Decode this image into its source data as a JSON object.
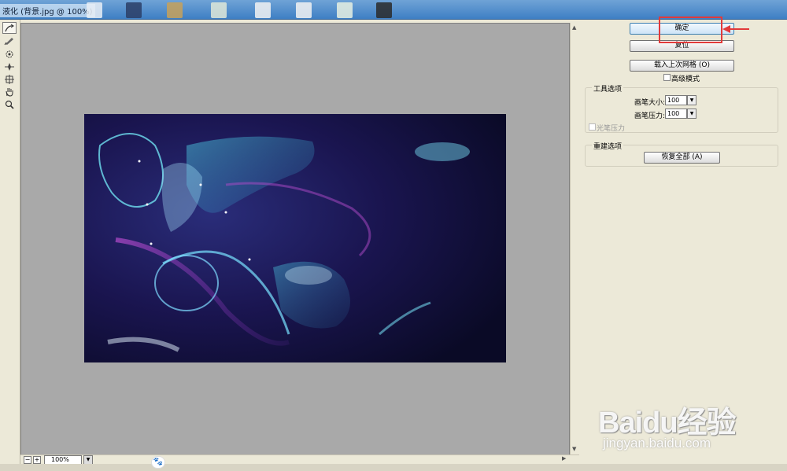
{
  "window": {
    "title": "液化 (背景.jpg @ 100%)"
  },
  "tools": [
    {
      "icon": "forward-warp-icon"
    },
    {
      "icon": "reconstruct-icon"
    },
    {
      "icon": "twirl-icon"
    },
    {
      "icon": "pucker-icon"
    },
    {
      "icon": "bloat-icon"
    },
    {
      "icon": "hand-icon"
    },
    {
      "icon": "zoom-icon"
    }
  ],
  "zoom": {
    "value": "100%"
  },
  "buttons": {
    "ok": "确定",
    "reset": "复位",
    "load_mesh": "载入上次网格 (O)",
    "restore_all": "恢复全部 (A)"
  },
  "advanced_mode": {
    "label": "高级模式",
    "checked": false
  },
  "tool_options": {
    "title": "工具选项",
    "brush_size": {
      "label": "画笔大小:",
      "value": "100"
    },
    "brush_pressure": {
      "label": "画笔压力:",
      "value": "100"
    },
    "stylus_pressure": {
      "label": "光笔压力",
      "checked": false
    }
  },
  "reconstruct_options": {
    "title": "重建选项"
  },
  "watermark": {
    "logo": "Baidu经验",
    "url": "jingyan.baidu.com"
  },
  "colors": {
    "highlight": "#e23a3a",
    "primary_button": "#cde4f7",
    "canvas_bg": "#a9a9a9"
  }
}
